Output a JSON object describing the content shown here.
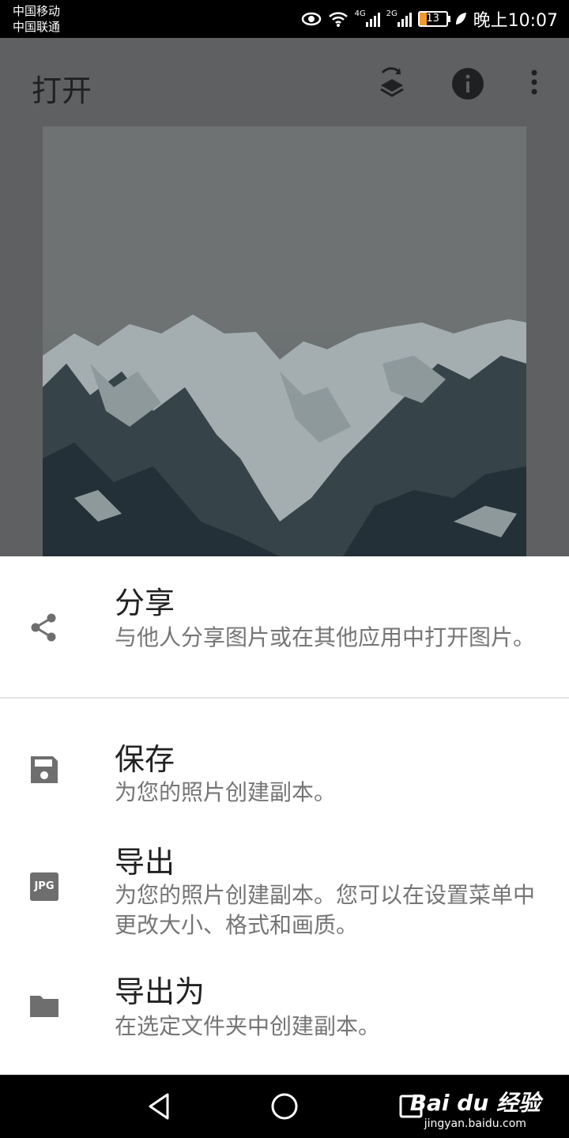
{
  "status_bar": {
    "carrier_1": "中国移动",
    "carrier_2": "中国联通",
    "network_1": "4G",
    "network_2": "2G",
    "battery": "13",
    "time": "晚上10:07"
  },
  "app_bar": {
    "title": "打开",
    "icons": [
      "layers-swap-icon",
      "info-icon",
      "more-vert-icon"
    ]
  },
  "bottom_sheet": {
    "items": [
      {
        "icon": "share-icon",
        "title": "分享",
        "description": "与他人分享图片或在其他应用中打开图片。"
      },
      {
        "icon": "save-icon",
        "title": "保存",
        "description": "为您的照片创建副本。"
      },
      {
        "icon": "jpg-icon",
        "icon_text": "JPG",
        "title": "导出",
        "description": "为您的照片创建副本。您可以在设置菜单中更改大小、格式和画质。"
      },
      {
        "icon": "folder-icon",
        "title": "导出为",
        "description": "在选定文件夹中创建副本。"
      }
    ]
  },
  "watermark": {
    "line1": "Bai du 经验",
    "line2": "jingyan.baidu.com"
  },
  "colors": {
    "accent_battery": "#f19a2b",
    "dim_background": "#5f6061",
    "icon_gray": "#6e6e6e"
  }
}
